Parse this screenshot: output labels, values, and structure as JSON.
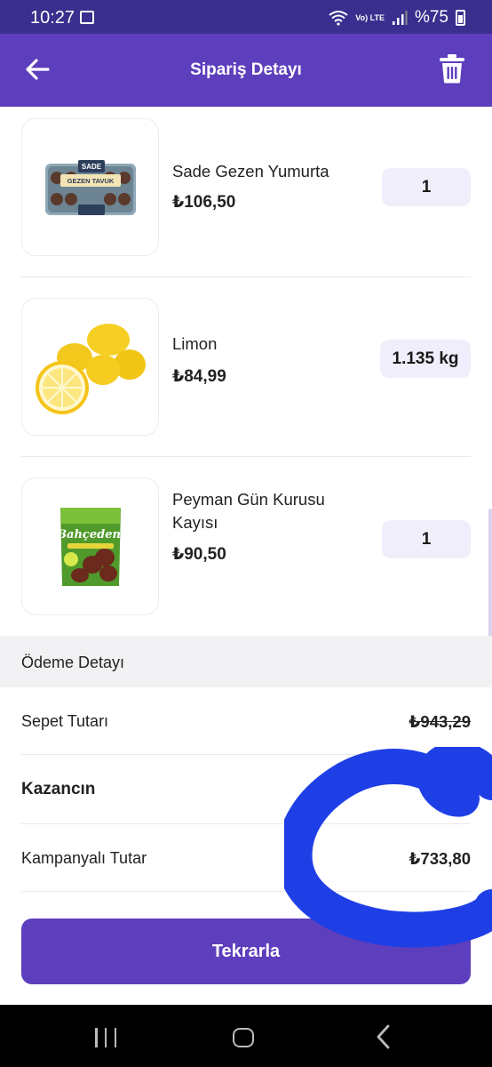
{
  "status_bar": {
    "time": "10:27",
    "network": "Vo) LTE",
    "battery": "%75"
  },
  "header": {
    "title": "Sipariş Detayı",
    "accent_color": "#5d3ebc"
  },
  "items": [
    {
      "name": "Sade Gezen Yumurta",
      "price": "₺106,50",
      "quantity": "1",
      "image": "egg-carton-image"
    },
    {
      "name": "Limon",
      "price": "₺84,99",
      "quantity": "1.135 kg",
      "image": "lemons-image"
    },
    {
      "name": "Peyman Gün Kurusu Kayısı",
      "price": "₺90,50",
      "quantity": "1",
      "image": "dried-apricot-pack-image"
    }
  ],
  "payment": {
    "section_title": "Ödeme Detayı",
    "rows": [
      {
        "label": "Sepet Tutarı",
        "value": "₺943,29"
      },
      {
        "label": "Kazancın",
        "value": ""
      },
      {
        "label": "Kampanyalı Tutar",
        "value": "₺733,80"
      }
    ]
  },
  "actions": {
    "repeat_label": "Tekrarla"
  },
  "product_labels": {
    "egg_brand": "SADE",
    "egg_subtitle": "GEZEN TAVUK",
    "apricot_brand": "Bahçeden"
  }
}
